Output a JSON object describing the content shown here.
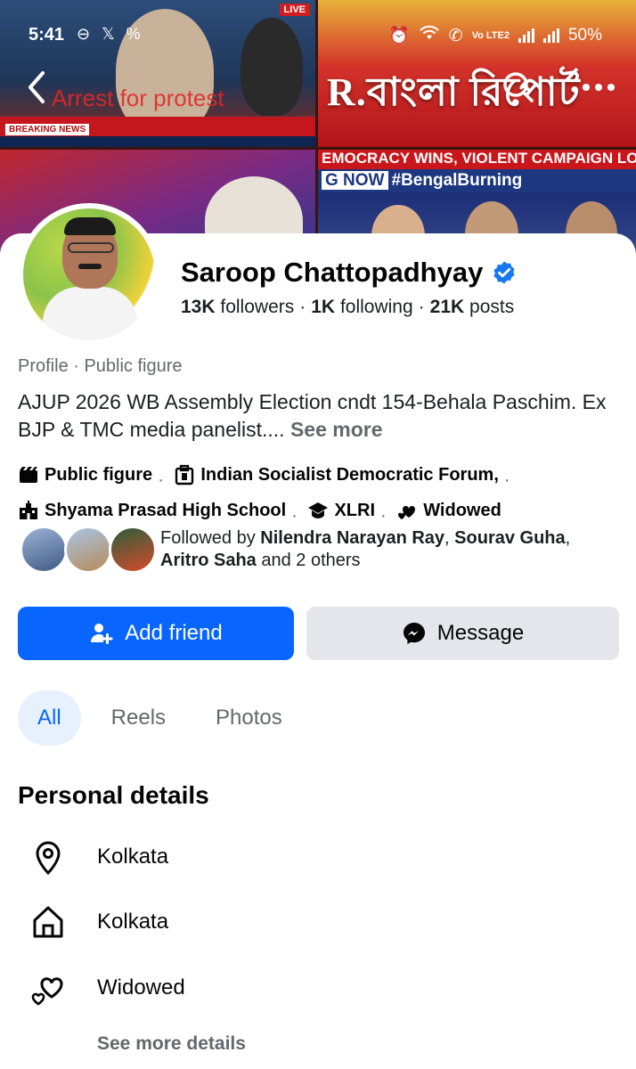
{
  "status_bar": {
    "time": "5:41",
    "left_icons": [
      "sync-icon",
      "x-icon",
      "percent-icon"
    ],
    "network": "Vo LTE2",
    "battery": "50%"
  },
  "cover": {
    "overlay_caption": "Arrest for protest",
    "live_badge": "LIVE",
    "breaking_label": "BREAKING NEWS",
    "channel_title": "R.বাংলা রিপোর্ট",
    "ticker_top": "EMOCRACY WINS, VIOLENT CAMPAIGN LO",
    "ticker_now": "G NOW",
    "ticker_hashtag": "#BengalBurning"
  },
  "profile": {
    "name": "Saroop Chattopadhyay",
    "verified": true,
    "followers_count": "13K",
    "followers_label": "followers",
    "following_count": "1K",
    "following_label": "following",
    "posts_count": "21K",
    "posts_label": "posts",
    "category": "Profile · Public figure",
    "bio": "AJUP 2026 WB Assembly Election cndt 154-Behala Paschim. Ex BJP & TMC media panelist.... ",
    "bio_see_more": "See more",
    "chips": {
      "public_figure": "Public figure",
      "work": "Indian Socialist Democratic Forum,",
      "school": "Shyama Prasad High School",
      "college": "XLRI",
      "relationship": "Widowed"
    },
    "followed_by": {
      "prefix": "Followed by ",
      "name1": "Nilendra Narayan Ray",
      "sep1": ", ",
      "name2": "Sourav Guha",
      "sep2": ", ",
      "name3": "Aritro Saha",
      "suffix": " and 2 others"
    }
  },
  "actions": {
    "add_friend": "Add friend",
    "message": "Message"
  },
  "tabs": [
    {
      "label": "All",
      "active": true
    },
    {
      "label": "Reels",
      "active": false
    },
    {
      "label": "Photos",
      "active": false
    }
  ],
  "personal_details": {
    "title": "Personal details",
    "items": [
      {
        "icon": "location-pin-icon",
        "text": "Kolkata"
      },
      {
        "icon": "home-icon",
        "text": "Kolkata"
      },
      {
        "icon": "hearts-icon",
        "text": "Widowed"
      }
    ],
    "see_more": "See more details"
  },
  "colors": {
    "primary_blue": "#0866ff",
    "secondary_gray": "#e4e6eb",
    "text_muted": "#65676b",
    "tab_active_bg": "#e7f0fd"
  }
}
